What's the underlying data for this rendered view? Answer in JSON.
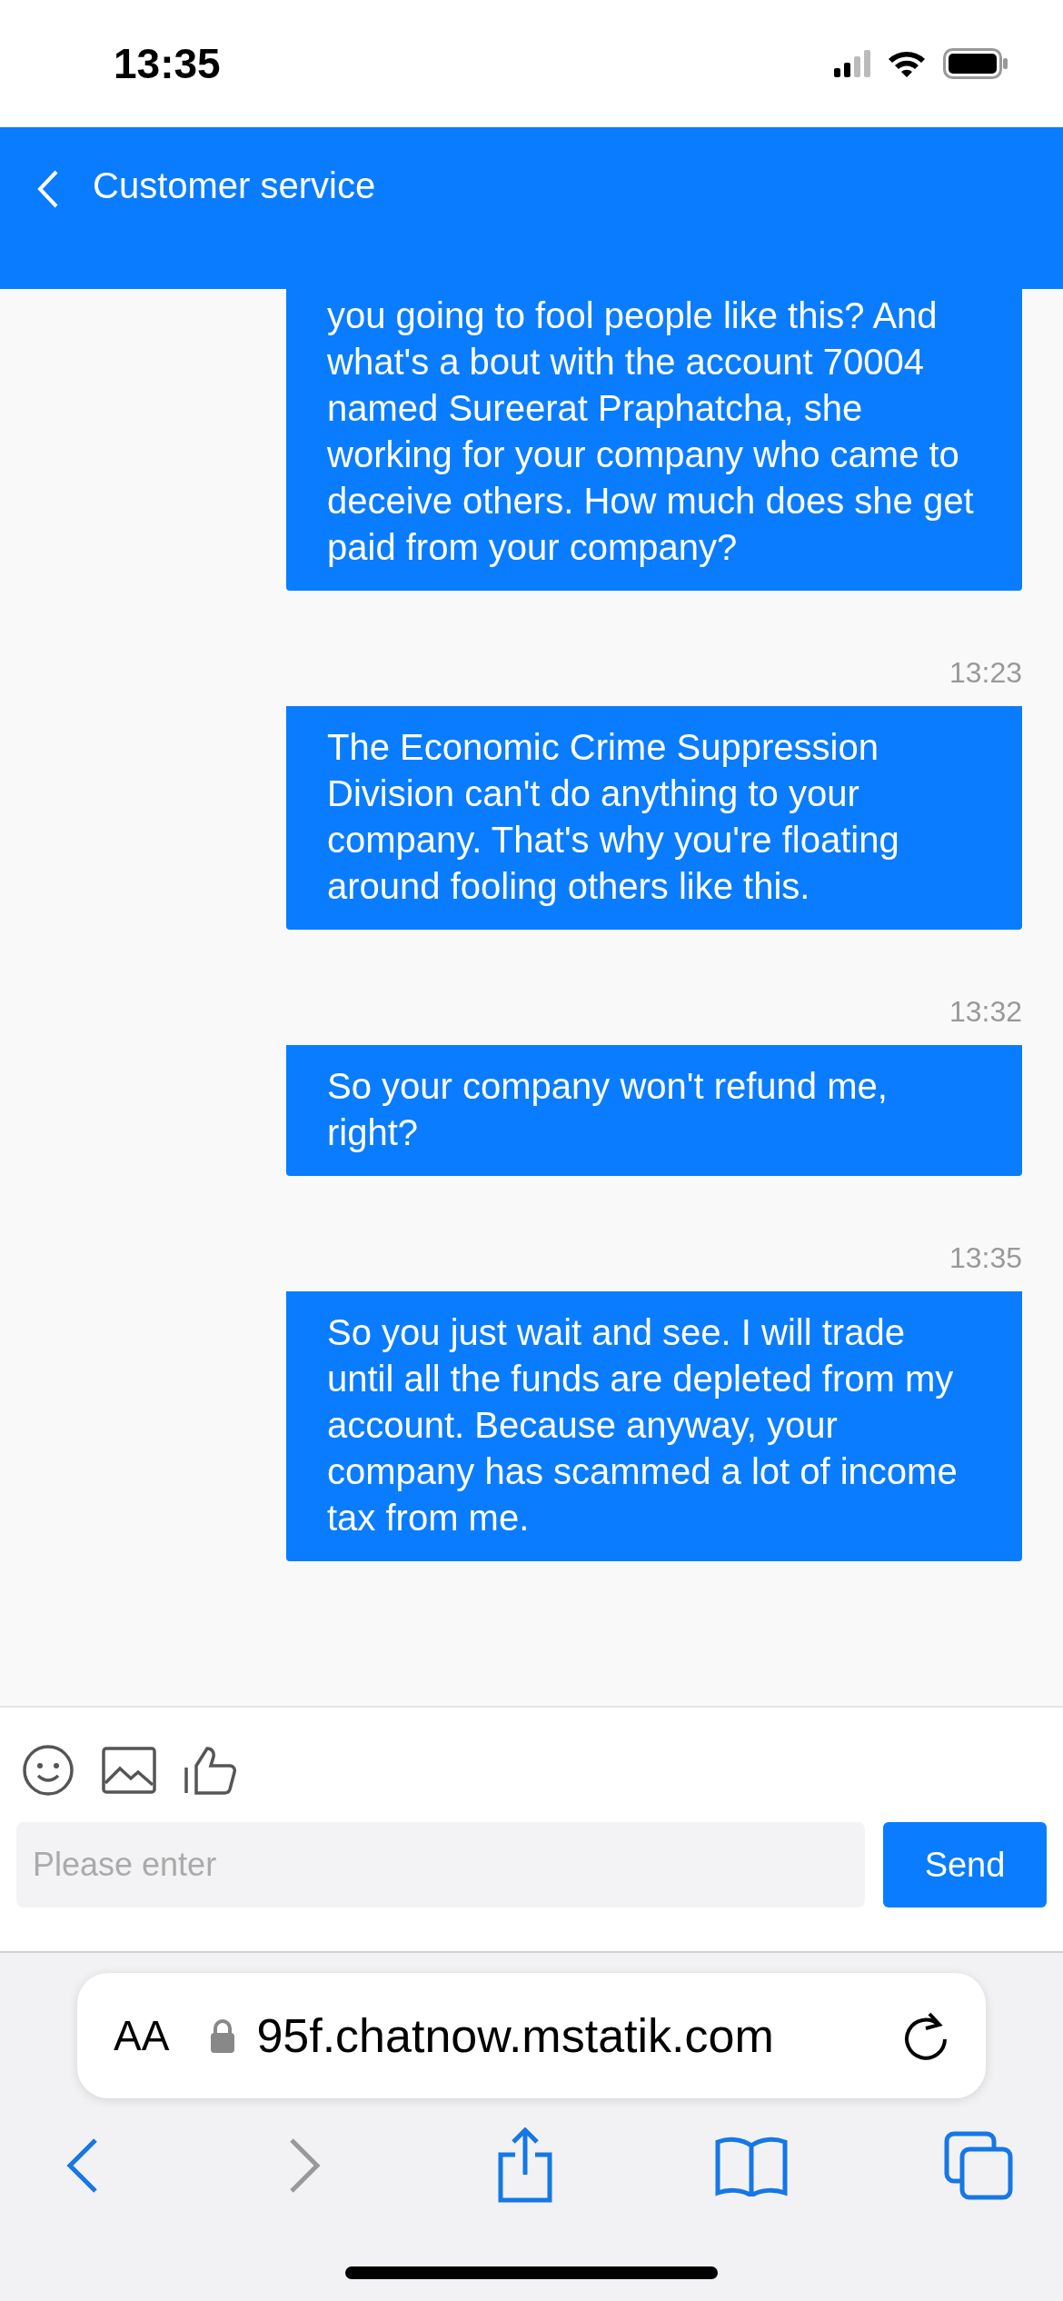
{
  "status_bar": {
    "time": "13:35"
  },
  "header": {
    "title": "Customer service"
  },
  "messages": [
    {
      "text": "you going to fool people like this? And what's a bout with the account 70004 named Sureerat Praphatcha, she working for your company who came to deceive others. How much does she get paid from your company?"
    },
    {
      "time": "13:23",
      "text": "The Economic Crime Suppression Division can't do anything to your company. That's why you're floating around fooling others like this."
    },
    {
      "time": "13:32",
      "text": "So your company won't refund me, right?"
    },
    {
      "time": "13:35",
      "text": "So you just wait and see. I will trade until all the funds are depleted from my account. Because anyway, your company has scammed a lot of income tax from me."
    }
  ],
  "composer": {
    "placeholder": "Please enter",
    "send": "Send"
  },
  "browser": {
    "text_size": "AA",
    "url": "95f.chatnow.mstatik.com",
    "nav": [
      {
        "kind": "back",
        "disabled": false
      },
      {
        "kind": "forward",
        "disabled": true
      },
      {
        "kind": "share",
        "disabled": false
      },
      {
        "kind": "bookmarks",
        "disabled": false
      },
      {
        "kind": "tabs",
        "disabled": false
      }
    ]
  }
}
